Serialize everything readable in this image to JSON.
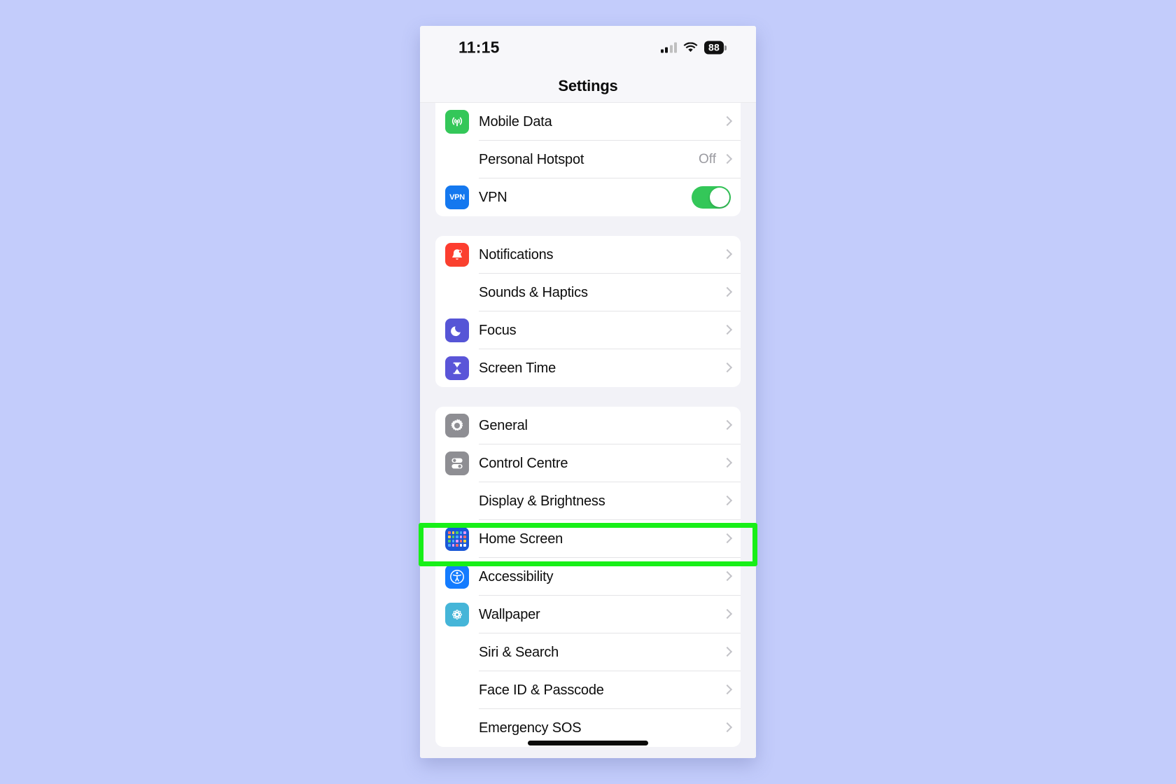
{
  "status_bar": {
    "time": "11:15",
    "battery_percent": "88",
    "cellular_icon": "cellular-signal-icon",
    "wifi_icon": "wifi-icon",
    "battery_icon": "battery-icon"
  },
  "nav_bar": {
    "title": "Settings"
  },
  "colors": {
    "page_background": "#c3ccfb",
    "screen_background": "#f2f2f7",
    "group_background": "#ffffff",
    "highlight": "#18ef18",
    "toggle_on": "#34c759",
    "chevron": "#c3c3c8",
    "secondary_text": "#9a9aa0"
  },
  "highlight": {
    "target_row": "Home Screen",
    "color": "#18ef18"
  },
  "groups": [
    {
      "id": "connectivity",
      "clipped_top": true,
      "rows": [
        {
          "label": "Mobile Data",
          "icon": "mobile-data-icon",
          "accessory": "chevron",
          "value": ""
        },
        {
          "label": "Personal Hotspot",
          "icon": "personal-hotspot-icon",
          "accessory": "chevron",
          "value": "Off"
        },
        {
          "label": "VPN",
          "icon": "vpn-icon",
          "accessory": "toggle",
          "value": "",
          "toggle_on": true
        }
      ]
    },
    {
      "id": "alerts",
      "clipped_top": false,
      "rows": [
        {
          "label": "Notifications",
          "icon": "notifications-icon",
          "accessory": "chevron",
          "value": ""
        },
        {
          "label": "Sounds & Haptics",
          "icon": "sounds-haptics-icon",
          "accessory": "chevron",
          "value": ""
        },
        {
          "label": "Focus",
          "icon": "focus-icon",
          "accessory": "chevron",
          "value": ""
        },
        {
          "label": "Screen Time",
          "icon": "screen-time-icon",
          "accessory": "chevron",
          "value": ""
        }
      ]
    },
    {
      "id": "system",
      "clipped_top": false,
      "rows": [
        {
          "label": "General",
          "icon": "general-icon",
          "accessory": "chevron",
          "value": ""
        },
        {
          "label": "Control Centre",
          "icon": "control-centre-icon",
          "accessory": "chevron",
          "value": ""
        },
        {
          "label": "Display & Brightness",
          "icon": "display-brightness-icon",
          "accessory": "chevron",
          "value": ""
        },
        {
          "label": "Home Screen",
          "icon": "home-screen-icon",
          "accessory": "chevron",
          "value": "",
          "highlighted": true
        },
        {
          "label": "Accessibility",
          "icon": "accessibility-icon",
          "accessory": "chevron",
          "value": ""
        },
        {
          "label": "Wallpaper",
          "icon": "wallpaper-icon",
          "accessory": "chevron",
          "value": ""
        },
        {
          "label": "Siri & Search",
          "icon": "siri-search-icon",
          "accessory": "chevron",
          "value": ""
        },
        {
          "label": "Face ID & Passcode",
          "icon": "face-id-passcode-icon",
          "accessory": "chevron",
          "value": ""
        },
        {
          "label": "Emergency SOS",
          "icon": "emergency-sos-icon",
          "accessory": "chevron",
          "value": ""
        }
      ]
    }
  ]
}
